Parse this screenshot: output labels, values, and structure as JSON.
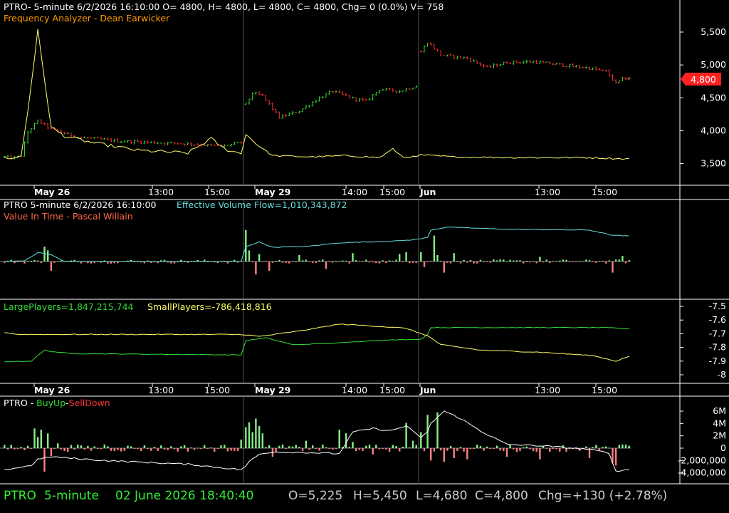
{
  "colors": {
    "background": "#000000",
    "grid": "#555555",
    "white": "#ffffff",
    "up": "#33dd33",
    "down": "#ff3333",
    "yellow": "#ffff66",
    "orange": "#ff9900",
    "cyan": "#66dddd",
    "salmon": "#ff6644",
    "upbar": "#88ee88",
    "downbar": "#ff8080",
    "status_green": "#33ee33",
    "status_grey": "#cccccc",
    "price_tag": "#ff2222"
  },
  "header": {
    "title": "PTRO- 5-minute 6/2/2026 16:10:00 O= 4800, H= 4800, L= 4800, C= 4800, Chg= 0 (0.0%) V= 758",
    "subtitle": "Frequency Analyzer - Dean Earwicker"
  },
  "panel2": {
    "title_left": "PTRO 5-minute  6/2/2026 16:10:00",
    "title_right": "Effective Volume Flow=1,010,343,872",
    "subtitle": "Value In Time - Pascal Willain"
  },
  "panel3": {
    "large_label": "LargePlayers=1,847,215,744",
    "small_label": "SmallPlayers=-786,418,816"
  },
  "panel4": {
    "prefix": "PTRO - ",
    "buy": "BuyUp",
    "dash": "-",
    "sell": "SellDown"
  },
  "status": {
    "symbol": "PTRO",
    "interval": "5-minute",
    "datetime": "02 June 2026 18:40:40",
    "open": "O=5,225",
    "high": "H=5,450",
    "low": "L=4,680",
    "close": "C=4,800",
    "change": "Chg=+130 (+2.78%)"
  },
  "price_tag": "4,800",
  "chart_data": [
    {
      "type": "candlestick",
      "name": "price-panel",
      "y_ticks": [
        "5,500",
        "5,000",
        "4,500",
        "4,000",
        "3,500"
      ],
      "y_tick_values": [
        5500,
        5000,
        4500,
        4000,
        3500
      ],
      "ylim": [
        3280,
        5780
      ],
      "x_labels": [
        "May 26",
        "13:00",
        "15:00",
        "May 29",
        "14:00",
        "15:00",
        "Jun",
        "13:00",
        "15:00"
      ],
      "bold_x_labels": [
        "May 26",
        "May 29",
        "Jun"
      ],
      "last_price": 4800,
      "segments": [
        {
          "n": 72,
          "keys": [
            [
              0,
              3600
            ],
            [
              3,
              3580
            ],
            [
              5,
              3620
            ],
            [
              7,
              3980
            ],
            [
              10,
              4150
            ],
            [
              14,
              4020
            ],
            [
              22,
              3900
            ],
            [
              35,
              3840
            ],
            [
              55,
              3800
            ],
            [
              65,
              3760
            ],
            [
              71,
              3820
            ]
          ]
        },
        {
          "n": 52,
          "keys": [
            [
              0,
              4400
            ],
            [
              2,
              4570
            ],
            [
              5,
              4530
            ],
            [
              10,
              4200
            ],
            [
              16,
              4300
            ],
            [
              22,
              4500
            ],
            [
              26,
              4600
            ],
            [
              32,
              4490
            ],
            [
              36,
              4450
            ],
            [
              40,
              4630
            ],
            [
              46,
              4600
            ],
            [
              51,
              4680
            ]
          ]
        },
        {
          "n": 64,
          "keys": [
            [
              0,
              5200
            ],
            [
              2,
              5350
            ],
            [
              4,
              5250
            ],
            [
              6,
              5150
            ],
            [
              14,
              5100
            ],
            [
              20,
              4960
            ],
            [
              26,
              5040
            ],
            [
              34,
              5050
            ],
            [
              44,
              4990
            ],
            [
              50,
              4960
            ],
            [
              56,
              4900
            ],
            [
              59,
              4720
            ],
            [
              61,
              4780
            ],
            [
              63,
              4800
            ]
          ]
        }
      ]
    },
    {
      "type": "line",
      "name": "frequency-analyzer",
      "segments": [
        {
          "n": 72,
          "keys": [
            [
              0,
              3590
            ],
            [
              3,
              3580
            ],
            [
              5,
              3620
            ],
            [
              7,
              4300
            ],
            [
              10,
              5520
            ],
            [
              14,
              4050
            ],
            [
              18,
              3920
            ],
            [
              26,
              3820
            ],
            [
              40,
              3700
            ],
            [
              55,
              3660
            ],
            [
              62,
              3880
            ],
            [
              66,
              3720
            ],
            [
              71,
              3650
            ]
          ]
        },
        {
          "n": 52,
          "keys": [
            [
              0,
              3950
            ],
            [
              3,
              3800
            ],
            [
              8,
              3620
            ],
            [
              20,
              3600
            ],
            [
              30,
              3620
            ],
            [
              40,
              3590
            ],
            [
              44,
              3720
            ],
            [
              47,
              3600
            ],
            [
              51,
              3600
            ]
          ]
        },
        {
          "n": 64,
          "keys": [
            [
              0,
              3630
            ],
            [
              10,
              3600
            ],
            [
              30,
              3590
            ],
            [
              50,
              3590
            ],
            [
              63,
              3570
            ]
          ]
        }
      ]
    },
    {
      "type": "bar+line",
      "name": "effective-volume-flow",
      "bar_series": "Value In Time",
      "line_series": "Effective Volume Flow",
      "spikes": [
        [
          12,
          1.6
        ],
        [
          13,
          1.2
        ],
        [
          14,
          -1.0
        ],
        [
          72,
          3.4
        ],
        [
          73,
          1.2
        ],
        [
          75,
          -1.4
        ],
        [
          76,
          0.8
        ],
        [
          79,
          -1.0
        ],
        [
          88,
          0.7
        ],
        [
          96,
          -0.8
        ],
        [
          104,
          0.9
        ],
        [
          118,
          0.8
        ],
        [
          120,
          1.0
        ],
        [
          124,
          1.0
        ],
        [
          125,
          -0.6
        ],
        [
          128,
          2.8
        ],
        [
          129,
          0.7
        ],
        [
          131,
          -1.2
        ],
        [
          134,
          0.9
        ],
        [
          160,
          0.5
        ],
        [
          182,
          -1.2
        ],
        [
          185,
          0.6
        ]
      ],
      "line_keys": [
        [
          0,
          0
        ],
        [
          6,
          0.1
        ],
        [
          10,
          1.2
        ],
        [
          14,
          0.9
        ],
        [
          18,
          0.0
        ],
        [
          71,
          0.0
        ],
        [
          72,
          2.0
        ],
        [
          76,
          2.6
        ],
        [
          80,
          1.9
        ],
        [
          90,
          2.0
        ],
        [
          100,
          2.5
        ],
        [
          115,
          2.7
        ],
        [
          122,
          2.9
        ],
        [
          126,
          3.2
        ],
        [
          127,
          4.2
        ],
        [
          132,
          4.6
        ],
        [
          150,
          4.3
        ],
        [
          175,
          4.2
        ],
        [
          182,
          3.5
        ],
        [
          187,
          3.4
        ]
      ]
    },
    {
      "type": "line",
      "name": "players",
      "y_ticks": [
        "-7.5",
        "-7.6",
        "-7.7",
        "-7.8",
        "-7.9",
        "-8"
      ],
      "y_tick_values": [
        -7.5,
        -7.6,
        -7.7,
        -7.8,
        -7.9,
        -8.0
      ],
      "ylim": [
        -8.05,
        -7.48
      ],
      "x_labels": [
        "May 26",
        "13:00",
        "15:00",
        "May 29",
        "14:00",
        "15:00",
        "Jun",
        "13:00",
        "15:00"
      ],
      "series": [
        {
          "name": "LargePlayers",
          "keys": [
            [
              0,
              -7.905
            ],
            [
              8,
              -7.9
            ],
            [
              12,
              -7.82
            ],
            [
              14,
              -7.83
            ],
            [
              20,
              -7.845
            ],
            [
              71,
              -7.855
            ],
            [
              72,
              -7.75
            ],
            [
              78,
              -7.73
            ],
            [
              86,
              -7.78
            ],
            [
              98,
              -7.77
            ],
            [
              110,
              -7.75
            ],
            [
              124,
              -7.74
            ],
            [
              126,
              -7.705
            ],
            [
              127,
              -7.655
            ],
            [
              180,
              -7.655
            ],
            [
              187,
              -7.665
            ]
          ]
        },
        {
          "name": "SmallPlayers",
          "keys": [
            [
              0,
              -7.69
            ],
            [
              4,
              -7.705
            ],
            [
              40,
              -7.705
            ],
            [
              71,
              -7.705
            ],
            [
              76,
              -7.72
            ],
            [
              82,
              -7.7
            ],
            [
              88,
              -7.68
            ],
            [
              94,
              -7.655
            ],
            [
              100,
              -7.63
            ],
            [
              108,
              -7.64
            ],
            [
              120,
              -7.66
            ],
            [
              126,
              -7.715
            ],
            [
              130,
              -7.78
            ],
            [
              142,
              -7.82
            ],
            [
              160,
              -7.835
            ],
            [
              176,
              -7.86
            ],
            [
              183,
              -7.9
            ],
            [
              187,
              -7.865
            ]
          ]
        }
      ]
    },
    {
      "type": "bar+line",
      "name": "buyup-selldown",
      "series": [
        {
          "name": "BuyUp"
        },
        {
          "name": "SellDown"
        }
      ],
      "y_ticks": [
        "6M",
        "4M",
        "2M",
        "0",
        "-2,000,000",
        "-4,000,000"
      ],
      "y_tick_values": [
        6,
        4,
        2,
        0,
        -2,
        -4
      ],
      "ylim": [
        -5.2,
        7.2
      ],
      "spikes": [
        [
          9,
          3.2
        ],
        [
          10,
          1.8
        ],
        [
          11,
          3.0
        ],
        [
          12,
          -3.8
        ],
        [
          13,
          2.4
        ],
        [
          14,
          -1.3
        ],
        [
          16,
          0.8
        ],
        [
          30,
          0.6
        ],
        [
          71,
          1.4
        ],
        [
          72,
          3.4
        ],
        [
          73,
          4.2
        ],
        [
          74,
          2.6
        ],
        [
          75,
          4.8
        ],
        [
          76,
          3.6
        ],
        [
          77,
          2.4
        ],
        [
          80,
          -1.4
        ],
        [
          90,
          1.2
        ],
        [
          100,
          3.0
        ],
        [
          102,
          2.4
        ],
        [
          104,
          1.0
        ],
        [
          110,
          -1.0
        ],
        [
          120,
          4.1
        ],
        [
          122,
          1.2
        ],
        [
          124,
          2.6
        ],
        [
          126,
          5.4
        ],
        [
          127,
          -2.0
        ],
        [
          129,
          5.8
        ],
        [
          131,
          -2.2
        ],
        [
          134,
          -1.6
        ],
        [
          138,
          -1.8
        ],
        [
          150,
          -1.4
        ],
        [
          160,
          -1.8
        ],
        [
          175,
          -1.6
        ],
        [
          182,
          -2.4
        ],
        [
          183,
          -2.8
        ],
        [
          185,
          0.6
        ]
      ],
      "line_keys": [
        [
          0,
          -3.5
        ],
        [
          8,
          -2.8
        ],
        [
          10,
          -1.8
        ],
        [
          14,
          -1.4
        ],
        [
          30,
          -2.0
        ],
        [
          55,
          -2.6
        ],
        [
          71,
          -3.5
        ],
        [
          73,
          -2.2
        ],
        [
          76,
          -1.0
        ],
        [
          80,
          -0.6
        ],
        [
          90,
          -0.7
        ],
        [
          100,
          -0.9
        ],
        [
          104,
          2.6
        ],
        [
          110,
          3.2
        ],
        [
          115,
          2.8
        ],
        [
          120,
          3.6
        ],
        [
          124,
          1.8
        ],
        [
          126,
          2.6
        ],
        [
          127,
          4.0
        ],
        [
          131,
          6.0
        ],
        [
          136,
          4.8
        ],
        [
          142,
          2.8
        ],
        [
          150,
          0.6
        ],
        [
          160,
          0.4
        ],
        [
          175,
          -0.2
        ],
        [
          181,
          -0.8
        ],
        [
          183,
          -3.8
        ],
        [
          187,
          -3.4
        ]
      ]
    }
  ]
}
